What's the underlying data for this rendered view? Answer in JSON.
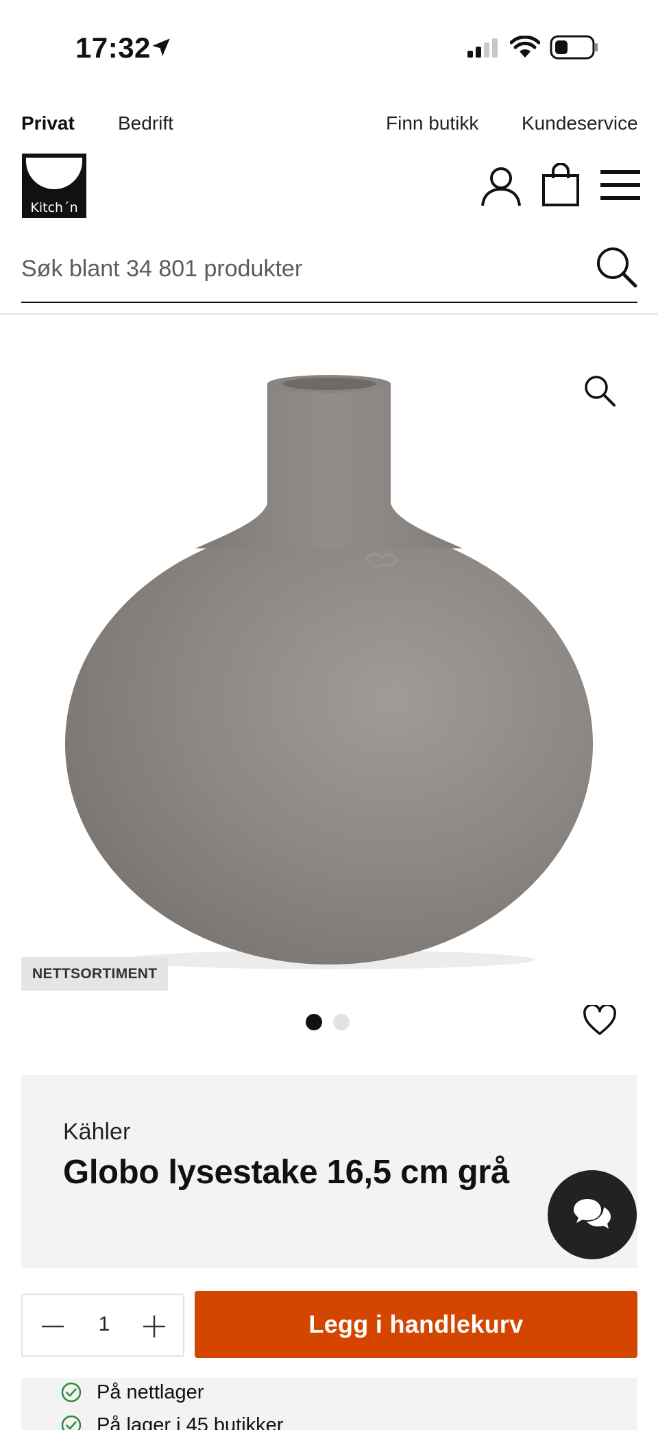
{
  "status_bar": {
    "time": "17:32",
    "icons": [
      "location-arrow-icon",
      "cellular-signal-icon",
      "wifi-icon",
      "battery-icon"
    ]
  },
  "top_links": {
    "privat": "Privat",
    "bedrift": "Bedrift",
    "finn_butikk": "Finn butikk",
    "kundeservice": "Kundeservice"
  },
  "header": {
    "logo_text": "Kitch´n",
    "icons": [
      "user-icon",
      "shopping-bag-icon",
      "menu-icon"
    ]
  },
  "search": {
    "placeholder": "Søk blant 34 801 produkter"
  },
  "product": {
    "badge": "NETTSORTIMENT",
    "image_count": 2,
    "active_image": 1,
    "brand": "Kähler",
    "title": "Globo lysestake 16,5 cm grå"
  },
  "purchase": {
    "quantity": "1",
    "add_to_cart_label": "Legg i handlekurv"
  },
  "stock": {
    "items": [
      "På nettlager",
      "På lager i 45 butikker"
    ]
  },
  "colors": {
    "accent": "#d44600",
    "dark": "#222222",
    "stock_check": "#2e8b3a",
    "card_bg": "#f4f3f3"
  }
}
